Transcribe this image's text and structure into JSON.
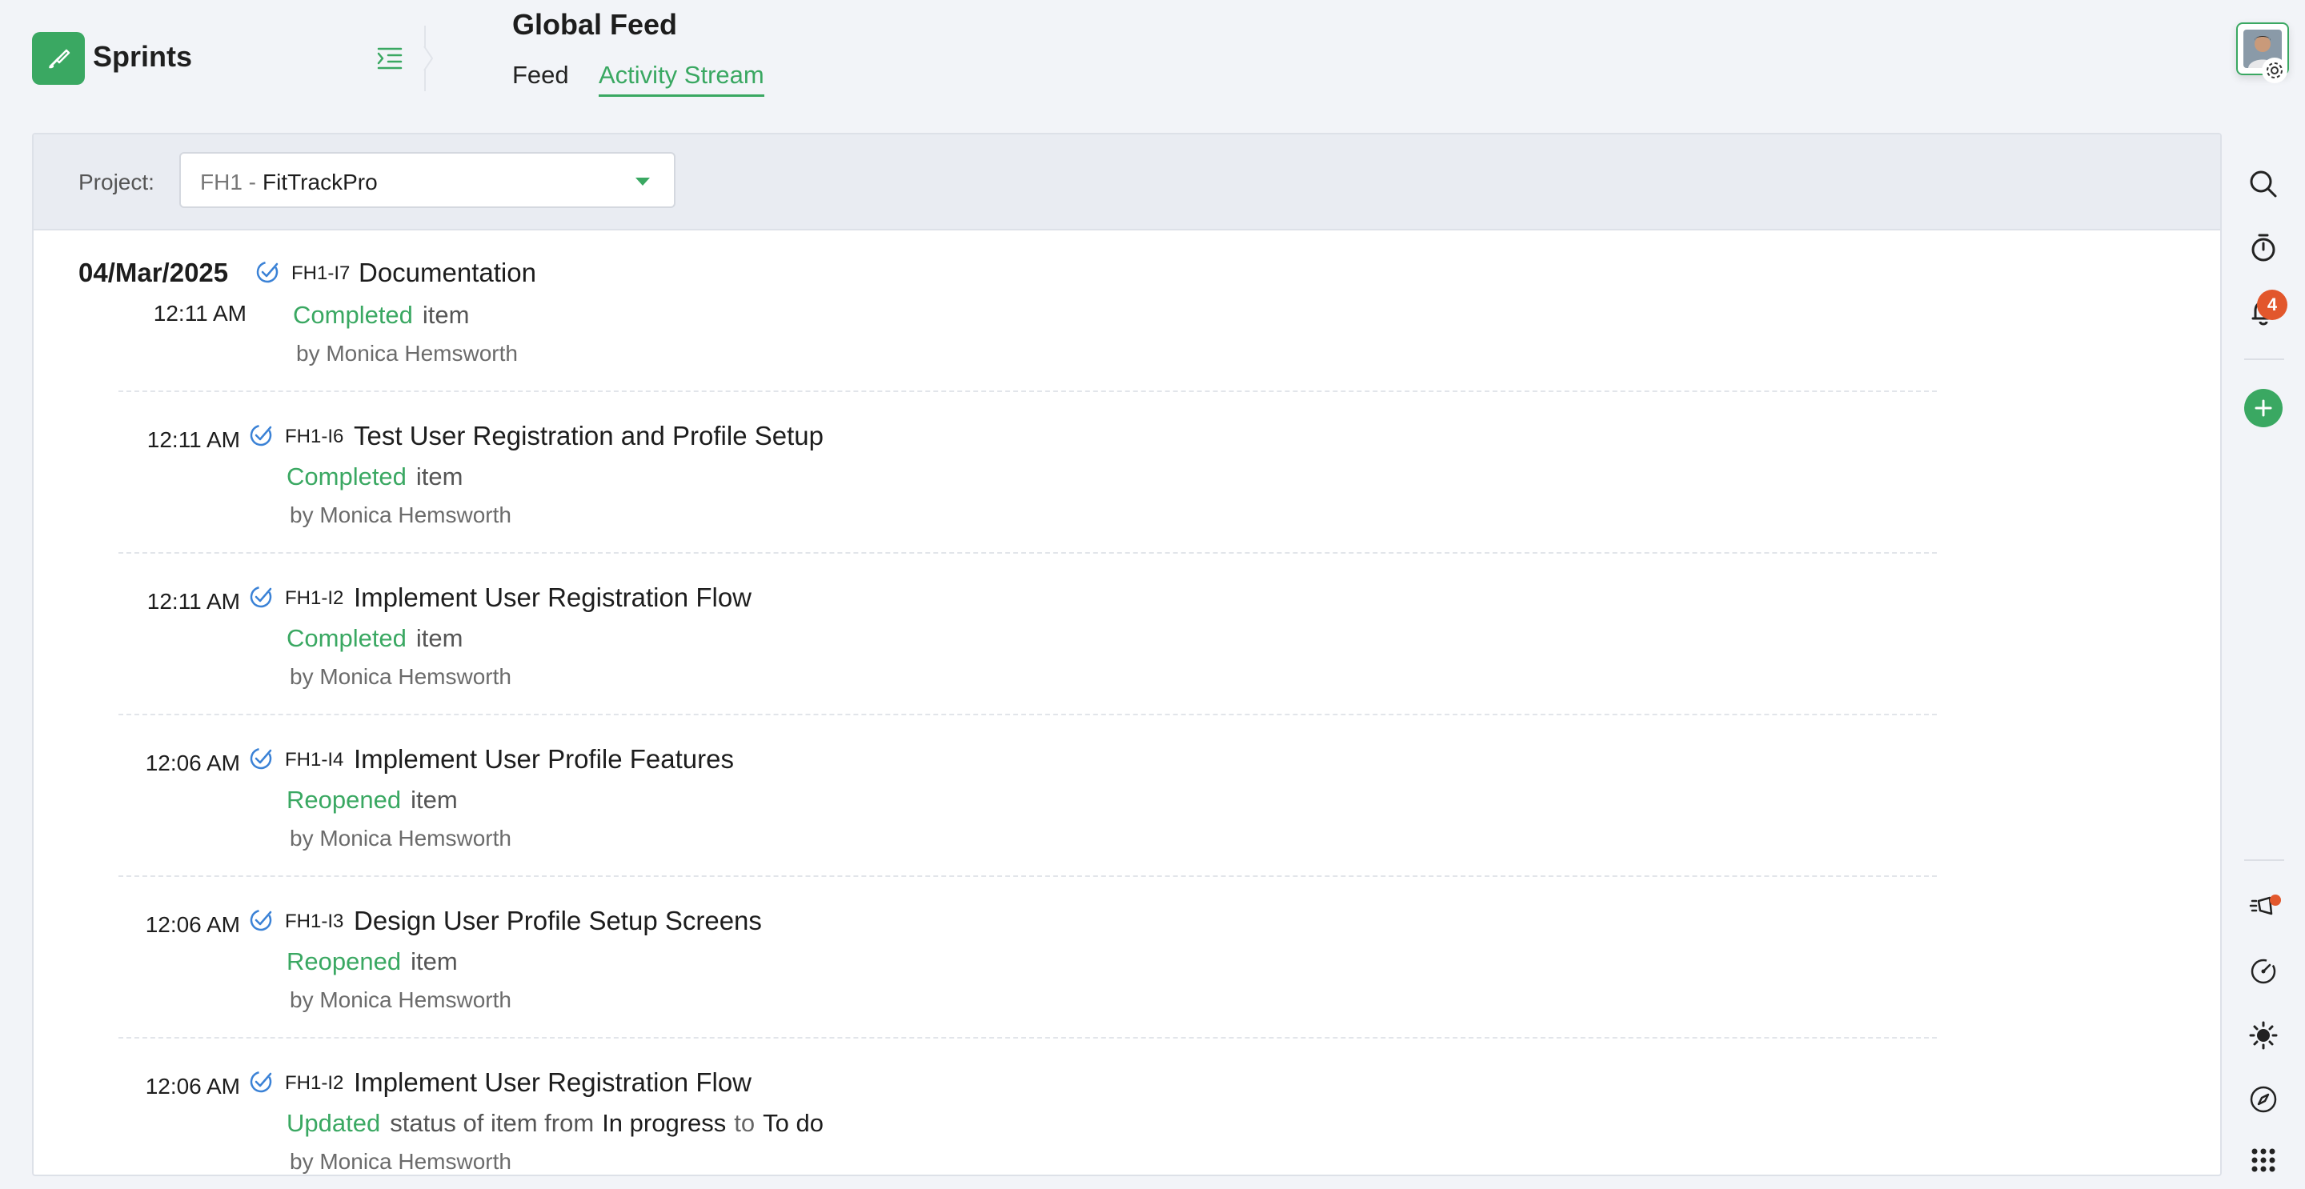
{
  "app": {
    "name": "Sprints"
  },
  "header": {
    "title": "Global Feed",
    "tabs": [
      {
        "label": "Feed",
        "active": false
      },
      {
        "label": "Activity Stream",
        "active": true
      }
    ]
  },
  "filter": {
    "label": "Project:",
    "project_code": "FH1 -",
    "project_name": "FitTrackPro"
  },
  "rail": {
    "notification_count": "4",
    "icons": [
      "search-icon",
      "timer-icon",
      "bell-icon",
      "plus-icon",
      "announcement-icon",
      "gauge-icon",
      "theme-icon",
      "compass-icon",
      "apps-grid-icon"
    ]
  },
  "colors": {
    "accent": "#3aa862",
    "badge": "#e2572c",
    "check": "#3b82d6"
  },
  "stream": {
    "date": "04/Mar/2025",
    "entries": [
      {
        "time": "12:11 AM",
        "code": "FH1-I7",
        "title": "Documentation",
        "verb": "Completed",
        "rest": "item",
        "by": "by Monica Hemsworth"
      },
      {
        "time": "12:11 AM",
        "code": "FH1-I6",
        "title": "Test User Registration and Profile Setup",
        "verb": "Completed",
        "rest": "item",
        "by": "by Monica Hemsworth"
      },
      {
        "time": "12:11 AM",
        "code": "FH1-I2",
        "title": "Implement User Registration Flow",
        "verb": "Completed",
        "rest": "item",
        "by": "by Monica Hemsworth"
      },
      {
        "time": "12:06 AM",
        "code": "FH1-I4",
        "title": "Implement User Profile Features",
        "verb": "Reopened",
        "rest": "item",
        "by": "by Monica Hemsworth"
      },
      {
        "time": "12:06 AM",
        "code": "FH1-I3",
        "title": "Design User Profile Setup Screens",
        "verb": "Reopened",
        "rest": "item",
        "by": "by Monica Hemsworth"
      },
      {
        "time": "12:06 AM",
        "code": "FH1-I2",
        "title": "Implement User Registration Flow",
        "verb": "Updated",
        "rest": "status of item from",
        "from": "In progress",
        "to_word": "to",
        "to": "To do",
        "by": "by Monica Hemsworth"
      }
    ]
  }
}
